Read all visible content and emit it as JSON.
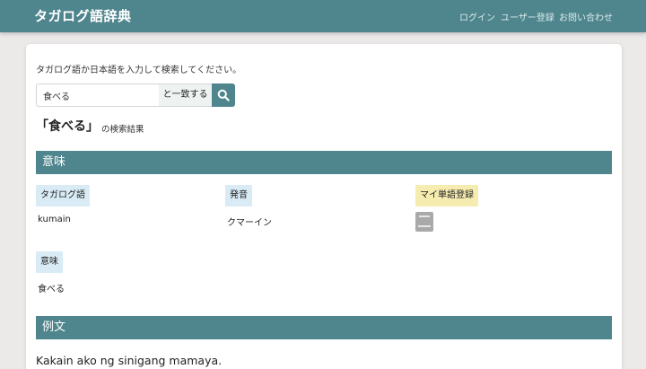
{
  "nav": {
    "brand": "タガログ語辞典",
    "login": "ログイン",
    "register": "ユーザー登録",
    "contact": "お問い合わせ"
  },
  "search": {
    "instruction": "タガログ語か日本語を入力して検索してください。",
    "value": "食べる",
    "match_mode": "と一致する",
    "button_icon": "search-icon"
  },
  "result": {
    "title": "「食べる」",
    "suffix": "の検索結果"
  },
  "meaning_section": {
    "header": "意味",
    "tagalog_label": "タガログ語",
    "tagalog_value": "kumain",
    "pronunciation_label": "発音",
    "pronunciation_value": "クマーイン",
    "my_word_label": "マイ単語登録",
    "my_word_icon": "book-icon",
    "meaning_label": "意味",
    "meaning_value": "食べる"
  },
  "example_section": {
    "header": "例文",
    "sentence": "Kakain ako ng sinigang mamaya."
  },
  "colors": {
    "accent": "#4f858d",
    "label_blue": "#d9ecf5",
    "label_yellow": "#f6ecb0",
    "background": "#ece9e9"
  }
}
